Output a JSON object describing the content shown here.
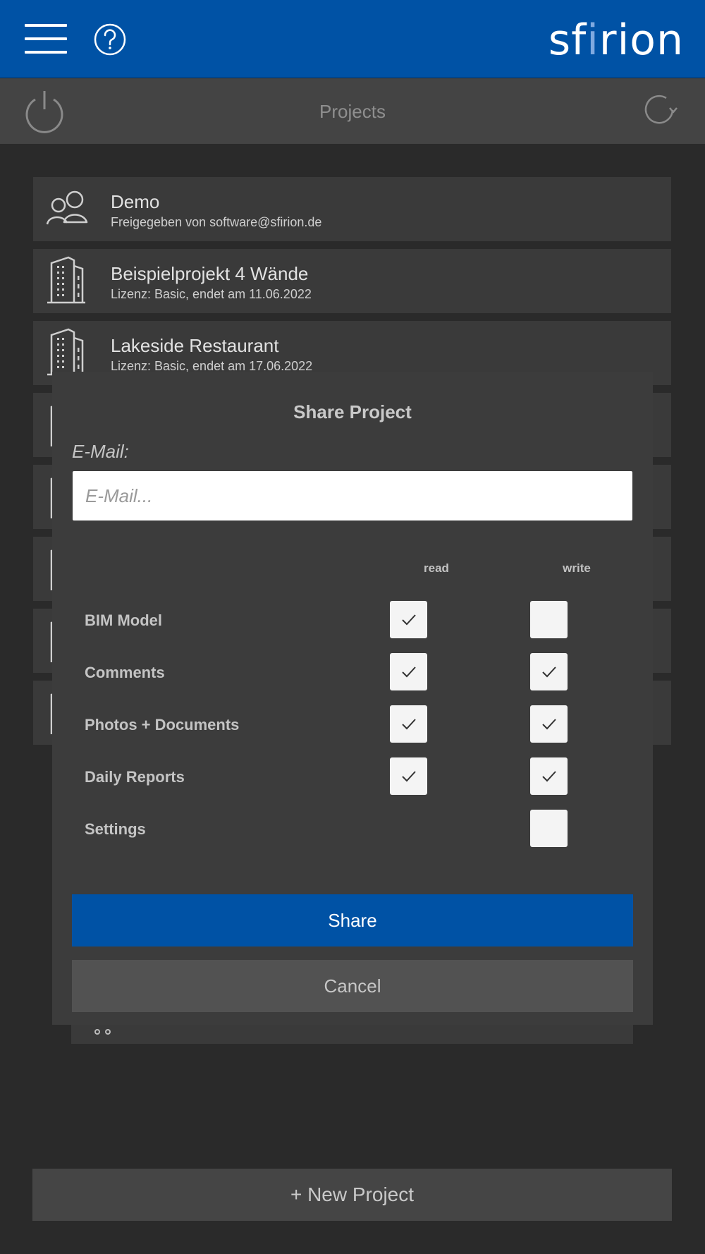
{
  "header": {
    "logo_pre": "sf",
    "logo_accent": "i",
    "logo_post": "rion",
    "menu_icon": "hamburger-menu-icon",
    "help_icon": "question-circle-icon"
  },
  "subheader": {
    "title": "Projects",
    "power_icon": "power-icon",
    "refresh_icon": "refresh-icon"
  },
  "projects": [
    {
      "name": "Demo",
      "subtitle": "Freigegeben von software@sfirion.de",
      "icon": "shared-users-icon"
    },
    {
      "name": "Beispielprojekt 4 Wände",
      "subtitle": "Lizenz: Basic, endet am 11.06.2022",
      "icon": "building-icon"
    },
    {
      "name": "Lakeside Restaurant",
      "subtitle": "Lizenz: Basic, endet am 17.06.2022",
      "icon": "building-icon"
    }
  ],
  "new_project_label": "+ New Project",
  "modal": {
    "title": "Share Project",
    "email_label": "E-Mail:",
    "email_placeholder": "E-Mail...",
    "email_value": "",
    "col_read": "read",
    "col_write": "write",
    "permissions": [
      {
        "label": "BIM Model",
        "read": true,
        "write": false
      },
      {
        "label": "Comments",
        "read": true,
        "write": true
      },
      {
        "label": "Photos + Documents",
        "read": true,
        "write": true
      },
      {
        "label": "Daily Reports",
        "read": true,
        "write": true
      },
      {
        "label": "Settings",
        "read": null,
        "write": false
      }
    ],
    "share_label": "Share",
    "cancel_label": "Cancel"
  },
  "colors": {
    "brand_blue": "#0052a5",
    "background": "#2a2a2a",
    "modal_bg": "#3c3c3c"
  }
}
